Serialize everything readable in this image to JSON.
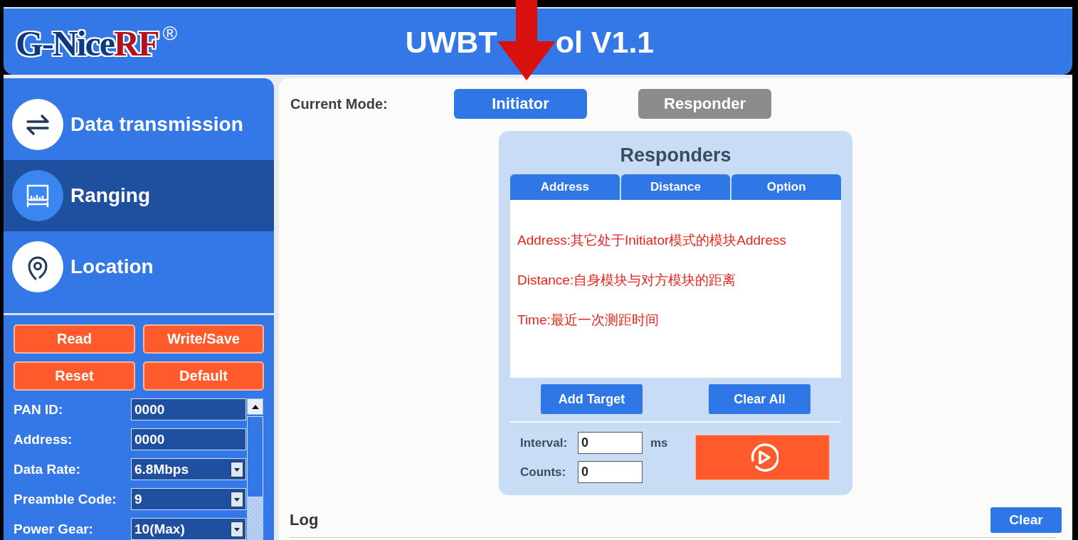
{
  "header": {
    "logo": {
      "text": "G-Nice",
      "accent": "RF",
      "mark": "®"
    },
    "title_parts": [
      "UWBT",
      "ol V1.1"
    ]
  },
  "sidebar": {
    "nav": [
      {
        "label": "Data transmission",
        "selected": false
      },
      {
        "label": "Ranging",
        "selected": true
      },
      {
        "label": "Location",
        "selected": false
      }
    ],
    "actions": [
      "Read",
      "Write/Save",
      "Reset",
      "Default"
    ],
    "fields": [
      {
        "label": "PAN ID:",
        "value": "0000",
        "kind": "text"
      },
      {
        "label": "Address:",
        "value": "0000",
        "kind": "text"
      },
      {
        "label": "Data Rate:",
        "value": "6.8Mbps",
        "kind": "select"
      },
      {
        "label": "Preamble Code:",
        "value": "9",
        "kind": "select"
      },
      {
        "label": "Power Gear:",
        "value": "10(Max)",
        "kind": "select"
      }
    ]
  },
  "mode": {
    "label": "Current Mode:",
    "options": [
      {
        "label": "Initiator",
        "selected": true
      },
      {
        "label": "Responder",
        "selected": false
      }
    ]
  },
  "responders": {
    "title": "Responders",
    "columns": [
      "Address",
      "Distance",
      "Option"
    ],
    "notes": [
      "Address:其它处于Initiator模式的模块Address",
      "Distance:自身模块与对方模块的距离",
      "Time:最近一次测距时间"
    ],
    "buttons": [
      "Add Target",
      "Clear All"
    ],
    "interval": {
      "label": "Interval:",
      "value": "0",
      "unit": "ms"
    },
    "counts": {
      "label": "Counts:",
      "value": "0"
    }
  },
  "log": {
    "title": "Log",
    "clear_button": "Clear"
  }
}
